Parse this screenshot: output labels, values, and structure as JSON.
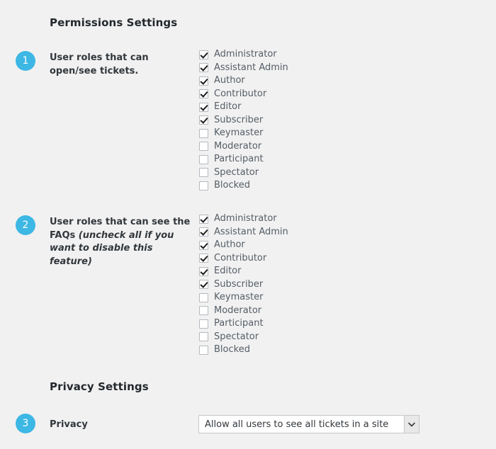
{
  "sections": {
    "permissions_heading": "Permissions Settings",
    "privacy_heading": "Privacy Settings"
  },
  "rows": [
    {
      "step": "1",
      "label": "User roles that can open/see tickets.",
      "hint": "",
      "roles": [
        {
          "label": "Administrator",
          "checked": true
        },
        {
          "label": "Assistant Admin",
          "checked": true
        },
        {
          "label": "Author",
          "checked": true
        },
        {
          "label": "Contributor",
          "checked": true
        },
        {
          "label": "Editor",
          "checked": true
        },
        {
          "label": "Subscriber",
          "checked": true
        },
        {
          "label": "Keymaster",
          "checked": false
        },
        {
          "label": "Moderator",
          "checked": false
        },
        {
          "label": "Participant",
          "checked": false
        },
        {
          "label": "Spectator",
          "checked": false
        },
        {
          "label": "Blocked",
          "checked": false
        }
      ]
    },
    {
      "step": "2",
      "label": "User roles that can see the FAQs ",
      "hint": "(uncheck all if you want to disable this feature)",
      "roles": [
        {
          "label": "Administrator",
          "checked": true
        },
        {
          "label": "Assistant Admin",
          "checked": true
        },
        {
          "label": "Author",
          "checked": true
        },
        {
          "label": "Contributor",
          "checked": true
        },
        {
          "label": "Editor",
          "checked": true
        },
        {
          "label": "Subscriber",
          "checked": true
        },
        {
          "label": "Keymaster",
          "checked": false
        },
        {
          "label": "Moderator",
          "checked": false
        },
        {
          "label": "Participant",
          "checked": false
        },
        {
          "label": "Spectator",
          "checked": false
        },
        {
          "label": "Blocked",
          "checked": false
        }
      ]
    },
    {
      "step": "3",
      "label": "Privacy",
      "hint": "",
      "select": {
        "value": "Allow all users to see all tickets in a site",
        "icon": "chevron-down-icon"
      }
    }
  ],
  "colors": {
    "background": "#f1f1f1",
    "badge": "#3db7e4",
    "heading": "#23282d",
    "label": "#32373c",
    "checkbox_label": "#555d66"
  }
}
